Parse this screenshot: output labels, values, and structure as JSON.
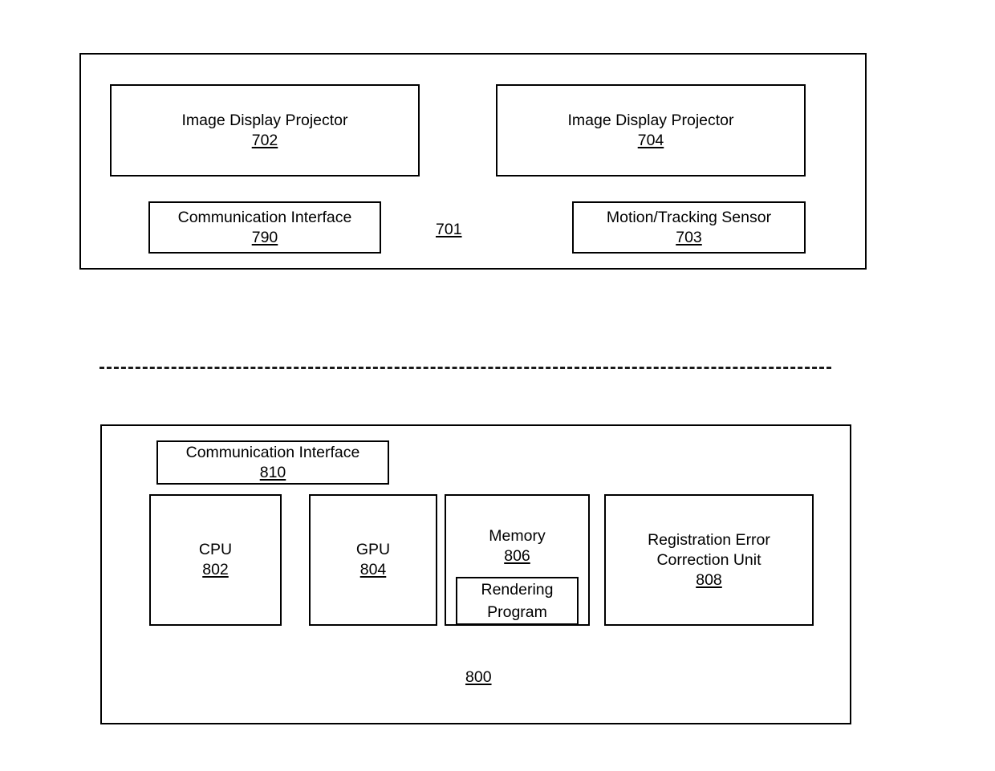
{
  "figure": {
    "type": "patent-block-diagram",
    "background_color": "#ffffff",
    "line_color": "#000000"
  },
  "head_mounted_unit": {
    "container_ref": "701",
    "blocks": [
      {
        "title": "Image Display Projector",
        "ref": "702"
      },
      {
        "title": "Image Display Projector",
        "ref": "704"
      },
      {
        "title": "Communication Interface",
        "ref": "790"
      },
      {
        "title": "Motion/Tracking Sensor",
        "ref": "703"
      }
    ]
  },
  "computing_unit": {
    "container_ref": "800",
    "blocks": [
      {
        "title": "Communication Interface",
        "ref": "810"
      },
      {
        "title": "CPU",
        "ref": "802"
      },
      {
        "title": "GPU",
        "ref": "804"
      },
      {
        "title": "Memory",
        "ref": "806",
        "sub_block": "Rendering\nProgram"
      },
      {
        "title": "Registration Error Correction Unit",
        "ref": "808"
      }
    ],
    "memory_sub_block": {
      "line1": "Rendering",
      "line2": "Program"
    }
  }
}
